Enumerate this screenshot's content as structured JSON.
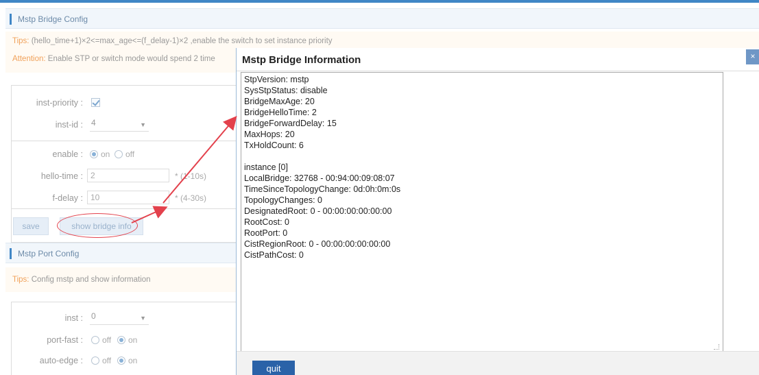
{
  "bridge_config": {
    "title": "Mstp Bridge Config",
    "tips_label": "Tips:",
    "tips_text": "(hello_time+1)×2<=max_age<=(f_delay-1)×2 ,enable the switch to set instance priority",
    "attention_label": "Attention:",
    "attention_text": "Enable STP or switch mode would spend 2 time",
    "inst_priority_label": "inst-priority :",
    "inst_id_label": "inst-id :",
    "inst_id_value": "4",
    "enable_label": "enable :",
    "enable_on": "on",
    "enable_off": "off",
    "hello_time_label": "hello-time :",
    "hello_time_value": "2",
    "hello_time_hint": "* (1-10s)",
    "f_delay_label": "f-delay :",
    "f_delay_value": "10",
    "f_delay_hint": "* (4-30s)",
    "save_label": "save",
    "show_info_label": "show bridge info"
  },
  "port_config": {
    "title": "Mstp Port Config",
    "tips_label": "Tips:",
    "tips_text": "Config mstp and show information",
    "inst_label": "inst :",
    "inst_value": "0",
    "port_fast_label": "port-fast :",
    "port_fast_off": "off",
    "port_fast_on": "on",
    "auto_edge_label": "auto-edge :",
    "auto_edge_off": "off",
    "auto_edge_on": "on"
  },
  "modal": {
    "title": "Mstp Bridge Information",
    "close_icon": "×",
    "info_text": "StpVersion: mstp\nSysStpStatus: disable\nBridgeMaxAge: 20\nBridgeHelloTime: 2\nBridgeForwardDelay: 15\nMaxHops: 20\nTxHoldCount: 6\n\ninstance [0]\nLocalBridge: 32768 - 00:94:00:09:08:07\nTimeSinceTopologyChange: 0d:0h:0m:0s\nTopologyChanges: 0\nDesignatedRoot: 0 - 00:00:00:00:00:00\nRootCost: 0\nRootPort: 0\nCistRegionRoot: 0 - 00:00:00:00:00:00\nCistPathCost: 0",
    "quit_label": "quit"
  },
  "colors": {
    "accent": "#3f86c6",
    "annotation_red": "#e3414c",
    "quit_button": "#2a62a8"
  }
}
